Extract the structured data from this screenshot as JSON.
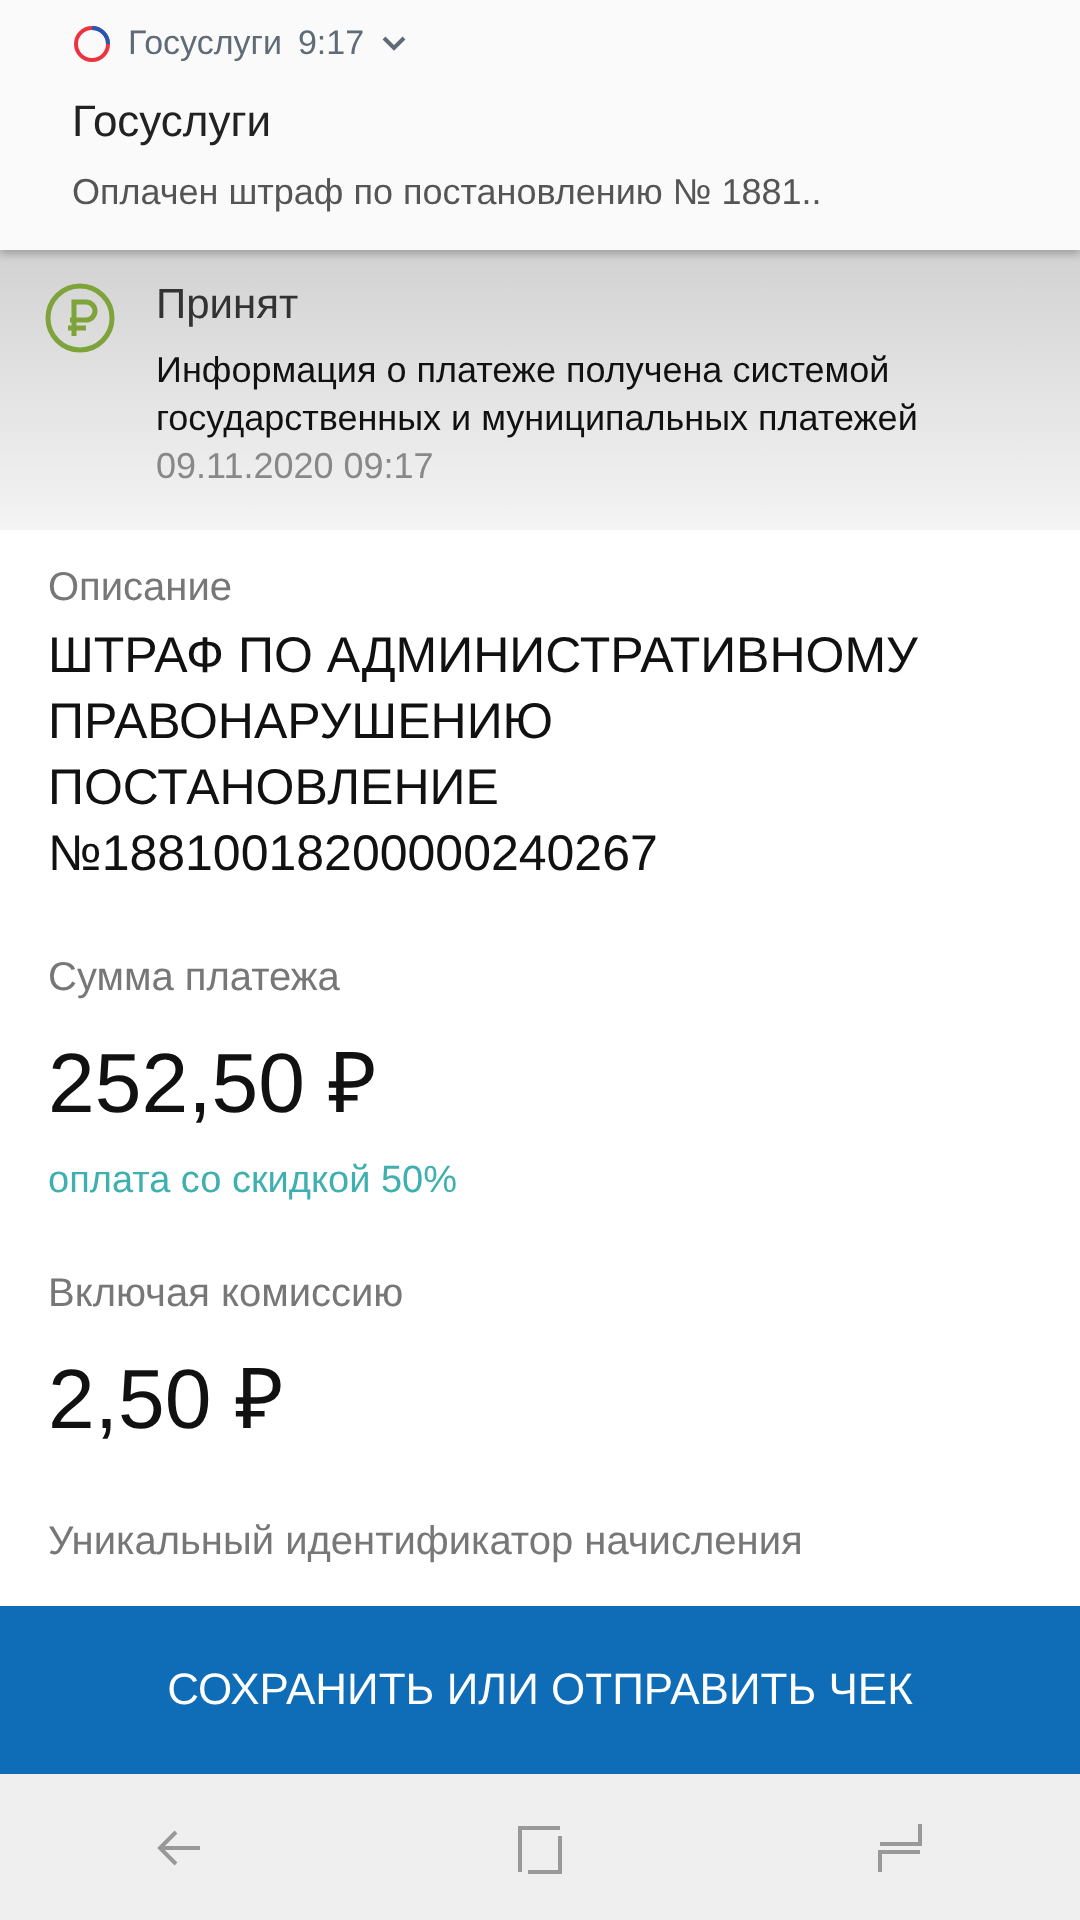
{
  "notification": {
    "app_name": "Госуслуги",
    "time": "9:17",
    "expanded": false,
    "title": "Госуслуги",
    "text": "Оплачен штраф по постановлению № 1881.."
  },
  "status": {
    "title": "Принят",
    "message": "Информация о платеже получена системой государственных и муниципальных платежей",
    "date": "09.11.2020 09:17"
  },
  "fields": [
    {
      "kind": "text",
      "label": "Описание",
      "value": "ШТРАФ ПО АДМИНИСТРАТИВНОМУ ПРАВОНАРУШЕНИЮ ПОСТАНОВЛЕНИЕ №18810018200000240267"
    },
    {
      "kind": "amount",
      "label": "Сумма платежа",
      "value": "252,50 ₽",
      "note": "оплата со скидкой 50%"
    },
    {
      "kind": "amount",
      "label": "Включая комиссию",
      "value": "2,50 ₽"
    },
    {
      "kind": "text",
      "label": "Уникальный идентификатор начисления"
    }
  ],
  "action_button": "СОХРАНИТЬ ИЛИ ОТПРАВИТЬ ЧЕК"
}
